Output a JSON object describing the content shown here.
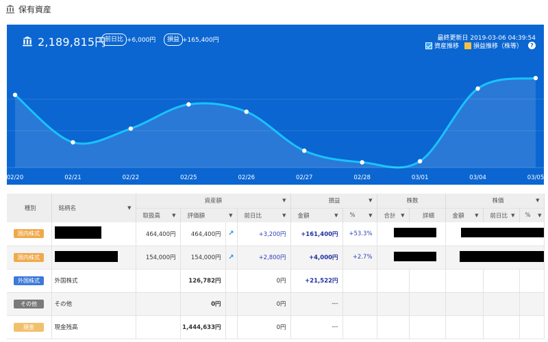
{
  "section": {
    "title": "保有資産",
    "icon": "bank-icon"
  },
  "summary": {
    "total": "2,189,815円",
    "prev_day_label": "前日比",
    "prev_day_value": "+6,000円",
    "profit_label": "損益",
    "profit_value": "+165,400円",
    "updated": "最終更新日 2019-03-06 04:39:54",
    "legend_asset": "資産推移",
    "legend_profit": "損益推移（株等）",
    "help": "?"
  },
  "colors": {
    "panel": "#0b66d1",
    "line": "#19c3ff",
    "profit_legend": "#f6c143",
    "badge_domestic": "#f0a94a",
    "badge_foreign": "#3c79d8",
    "badge_other": "#7a7a7a",
    "badge_cash": "#f1c06d"
  },
  "chart_data": {
    "type": "area",
    "title": "",
    "xlabel": "",
    "ylabel": "",
    "categories": [
      "02/20",
      "02/21",
      "02/22",
      "02/25",
      "02/26",
      "02/27",
      "02/28",
      "03/01",
      "03/04",
      "03/05"
    ],
    "series": [
      {
        "name": "資産推移",
        "values": [
          0.69,
          0.24,
          0.37,
          0.6,
          0.53,
          0.16,
          0.05,
          0.06,
          0.75,
          0.85
        ]
      }
    ],
    "ylim": [
      0,
      1
    ],
    "grid": true,
    "legend": "top-right"
  },
  "table": {
    "header_top": {
      "type": "種別",
      "name": "銘柄名",
      "assets": "資産額",
      "pl": "損益",
      "shares": "株数",
      "price": "株価"
    },
    "header_sub": {
      "acq": "取扱高",
      "valuation": "評価額",
      "prev": "前日比",
      "pl_amount": "金額",
      "pl_pct": "%",
      "sh_total": "合計",
      "sh_detail": "詳細",
      "pr_amount": "金額",
      "pr_prev": "前日比",
      "pr_pct": "%"
    },
    "rows": [
      {
        "badge": "国内株式",
        "name": "",
        "acq": "464,400円",
        "valuation": "464,400円",
        "prev": "+3,200円",
        "pl": "+161,400円",
        "pct": "+53.3%"
      },
      {
        "badge": "国内株式",
        "name": "",
        "acq": "154,000円",
        "valuation": "154,000円",
        "prev": "+2,800円",
        "pl": "+4,000円",
        "pct": "+2.7%"
      },
      {
        "badge": "外国株式",
        "name": "外国株式",
        "acq": "",
        "valuation": "126,782円",
        "prev": "0円",
        "pl": "+21,522円",
        "pct": ""
      },
      {
        "badge": "その他",
        "name": "その他",
        "acq": "",
        "valuation": "0円",
        "prev": "0円",
        "pl": "---",
        "pct": ""
      },
      {
        "badge": "現金",
        "name": "現金残高",
        "acq": "",
        "valuation": "1,444,633円",
        "prev": "0円",
        "pl": "---",
        "pct": ""
      }
    ]
  }
}
